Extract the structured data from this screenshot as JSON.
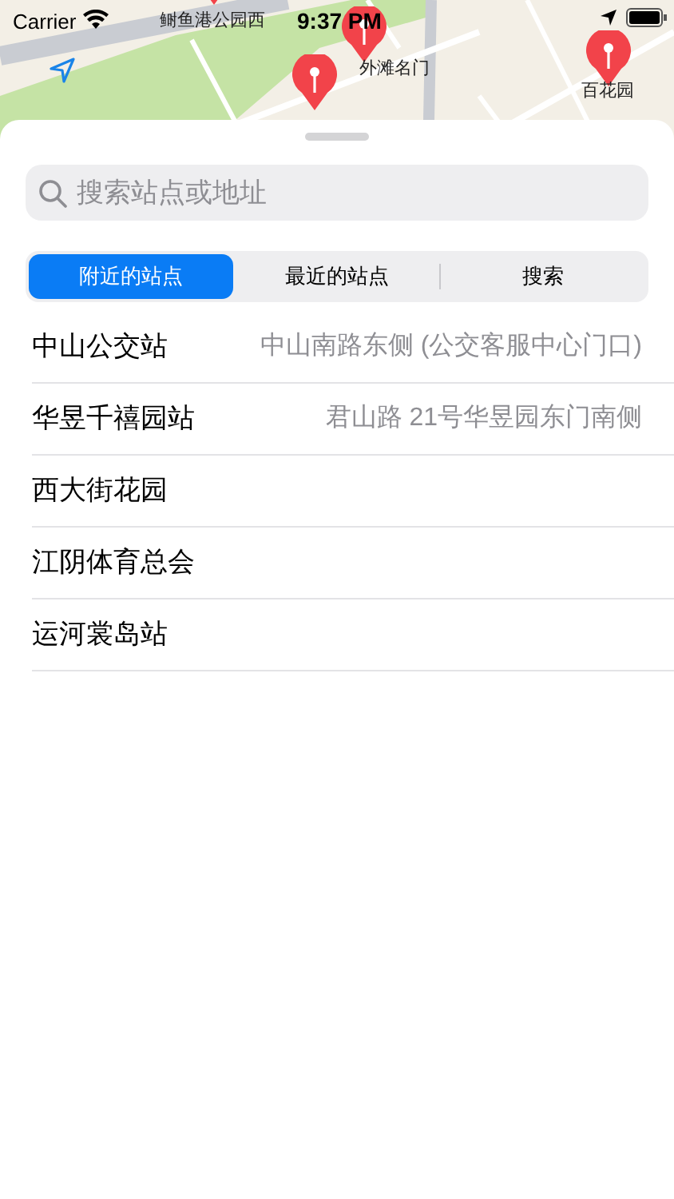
{
  "status_bar": {
    "carrier": "Carrier",
    "time": "9:37 PM"
  },
  "map": {
    "pins": [
      {
        "label": "鲥鱼港公园西"
      },
      {
        "label": "外滩名门"
      },
      {
        "label": "百花园"
      }
    ]
  },
  "search": {
    "placeholder": "搜索站点或地址"
  },
  "tabs": [
    {
      "label": "附近的站点",
      "selected": true
    },
    {
      "label": "最近的站点",
      "selected": false
    },
    {
      "label": "搜索",
      "selected": false
    }
  ],
  "stations": [
    {
      "name": "中山公交站",
      "address": "中山南路东侧 (公交客服中心门口)"
    },
    {
      "name": "华昱千禧园站",
      "address": "君山路 21号华昱园东门南侧"
    },
    {
      "name": "西大街花园"
    },
    {
      "name": "江阴体育总会"
    },
    {
      "name": "运河裳岛站"
    }
  ]
}
